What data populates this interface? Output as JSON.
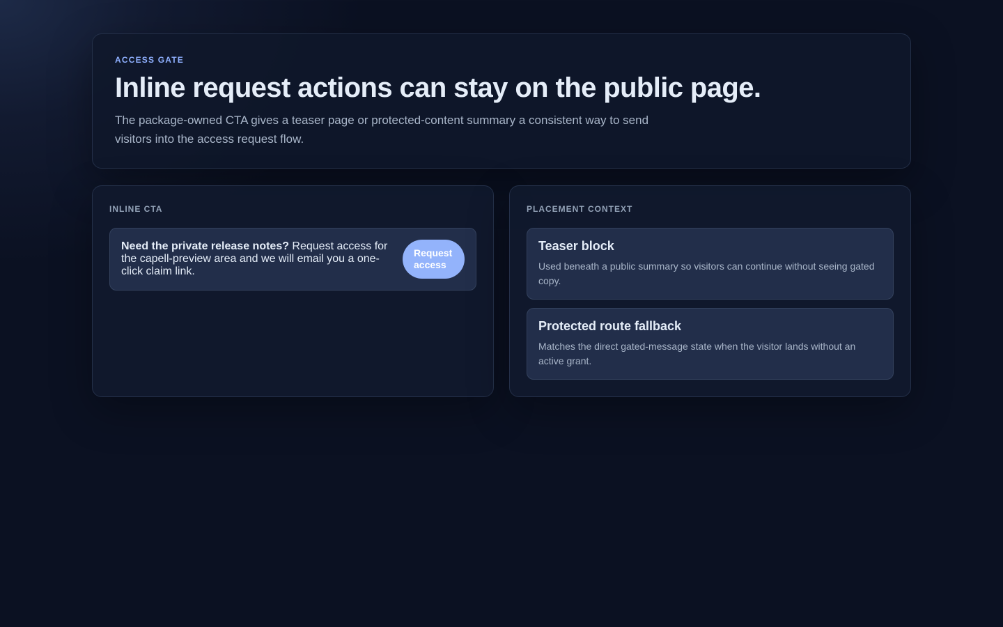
{
  "hero": {
    "eyebrow": "ACCESS GATE",
    "title": "Inline request actions can stay on the public page.",
    "description": "The package-owned CTA gives a teaser page or protected-content summary a consistent way to send visitors into the access request flow."
  },
  "inline_cta": {
    "label": "INLINE CTA",
    "lead": "Need the private release notes?",
    "body": " Request access for the capell-preview area and we will email you a one-click claim link.",
    "button_label": "Request access"
  },
  "placement_context": {
    "label": "PLACEMENT CONTEXT",
    "cards": [
      {
        "title": "Teaser block",
        "description": "Used beneath a public summary so visitors can continue without seeing gated copy."
      },
      {
        "title": "Protected route fallback",
        "description": "Matches the direct gated-message state when the visitor lands without an active grant."
      }
    ]
  },
  "colors": {
    "accent": "#8fb0ff",
    "button": "#93b3fb",
    "background": "#0b1122"
  }
}
